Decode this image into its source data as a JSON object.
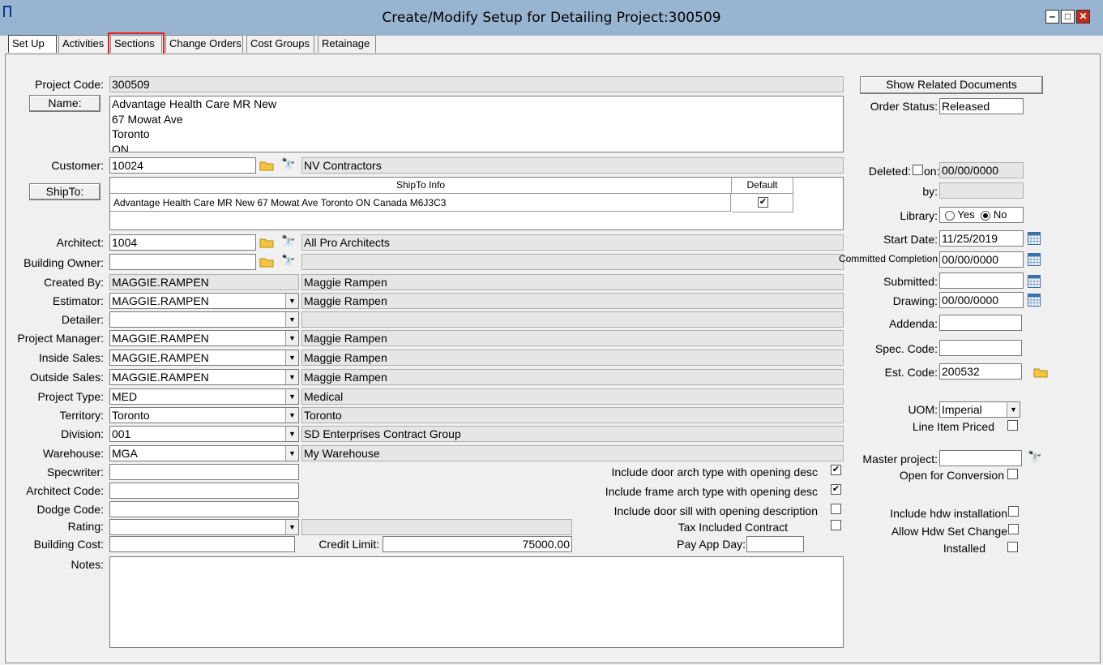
{
  "window": {
    "title": "Create/Modify Setup for Detailing Project:300509",
    "minimize": "‒",
    "maximize": "□",
    "close": "✕"
  },
  "tabs": [
    "Set Up",
    "Activities",
    "Sections",
    "Change Orders",
    "Cost Groups",
    "Retainage"
  ],
  "labels": {
    "project_code": "Project Code:",
    "customer": "Customer:",
    "architect": "Architect:",
    "building_owner": "Building Owner:",
    "created_by": "Created By:",
    "estimator": "Estimator:",
    "detailer": "Detailer:",
    "project_manager": "Project Manager:",
    "inside_sales": "Inside Sales:",
    "outside_sales": "Outside Sales:",
    "project_type": "Project Type:",
    "territory": "Territory:",
    "division": "Division:",
    "warehouse": "Warehouse:",
    "specwriter": "Specwriter:",
    "architect_code": "Architect Code:",
    "dodge_code": "Dodge Code:",
    "rating": "Rating:",
    "building_cost": "Building Cost:",
    "notes": "Notes:",
    "credit_limit": "Credit Limit:",
    "pay_app_day": "Pay App Day:",
    "order_status": "Order Status:",
    "deleted": "Deleted:",
    "on": "on:",
    "by": "by:",
    "library": "Library:",
    "yes": "Yes",
    "no": "No",
    "start_date": "Start Date:",
    "committed_completion": "Committed Completion",
    "submitted": "Submitted:",
    "drawing": "Drawing:",
    "addenda": "Addenda:",
    "spec_code": "Spec. Code:",
    "est_code": "Est. Code:",
    "uom": "UOM:",
    "line_item_priced": "Line Item Priced",
    "master_project": "Master project:",
    "open_for_conversion": "Open for Conversion",
    "include_hdw_installation": "Include hdw installation",
    "allow_hdw_set_change": "Allow Hdw Set Change",
    "installed": "Installed",
    "door_arch": "Include door arch type with opening desc",
    "frame_arch": "Include frame arch type with opening desc",
    "door_sill": "Include door sill with opening description",
    "tax_included": "Tax Included Contract"
  },
  "buttons": {
    "name": "Name:",
    "shipto": "ShipTo:",
    "show_related": "Show Related Documents"
  },
  "values": {
    "project_code": "300509",
    "name_lines": [
      "Advantage Health Care MR New",
      "67 Mowat Ave",
      "Toronto",
      "ON"
    ],
    "customer_code": "10024",
    "customer_name": "NV Contractors",
    "architect_code": "1004",
    "architect_name": "All Pro Architects",
    "building_owner_code": "",
    "building_owner_name": "",
    "created_by": "MAGGIE.RAMPEN",
    "created_by_name": "Maggie Rampen",
    "estimator": "MAGGIE.RAMPEN",
    "estimator_name": "Maggie Rampen",
    "detailer": "",
    "detailer_name": "",
    "project_manager": "MAGGIE.RAMPEN",
    "project_manager_name": "Maggie Rampen",
    "inside_sales": "MAGGIE.RAMPEN",
    "inside_sales_name": "Maggie Rampen",
    "outside_sales": "MAGGIE.RAMPEN",
    "outside_sales_name": "Maggie Rampen",
    "project_type": "MED",
    "project_type_name": "Medical",
    "territory": "Toronto",
    "territory_name": "Toronto",
    "division": "001",
    "division_name": "SD Enterprises Contract Group",
    "warehouse": "MGA",
    "warehouse_name": "My Warehouse",
    "specwriter": "",
    "architect_code_field": "",
    "dodge_code": "",
    "rating": "",
    "building_cost": "",
    "credit_limit": "75000.00",
    "pay_app_day": "",
    "notes": "",
    "order_status": "Released",
    "deleted_on": "00/00/0000",
    "deleted_by": "",
    "start_date": "11/25/2019",
    "committed_completion": "00/00/0000",
    "submitted": "",
    "drawing": "00/00/0000",
    "addenda": "",
    "spec_code": "",
    "est_code": "200532",
    "uom": "Imperial",
    "master_project": ""
  },
  "shipto_table": {
    "headers": [
      "ShipTo Info",
      "Default"
    ],
    "rows": [
      {
        "info": "Advantage Health Care MR New 67 Mowat Ave Toronto ON Canada M6J3C3",
        "default": true
      }
    ]
  },
  "checks": {
    "door_arch": true,
    "frame_arch": true,
    "door_sill": false,
    "tax_included": false,
    "deleted": false,
    "line_item_priced": false,
    "open_for_conversion": false,
    "include_hdw_installation": false,
    "allow_hdw_set_change": false,
    "installed": false,
    "library": "No"
  },
  "colors": {
    "titlebar": "#99b4d1",
    "highlight": "#e02020"
  }
}
